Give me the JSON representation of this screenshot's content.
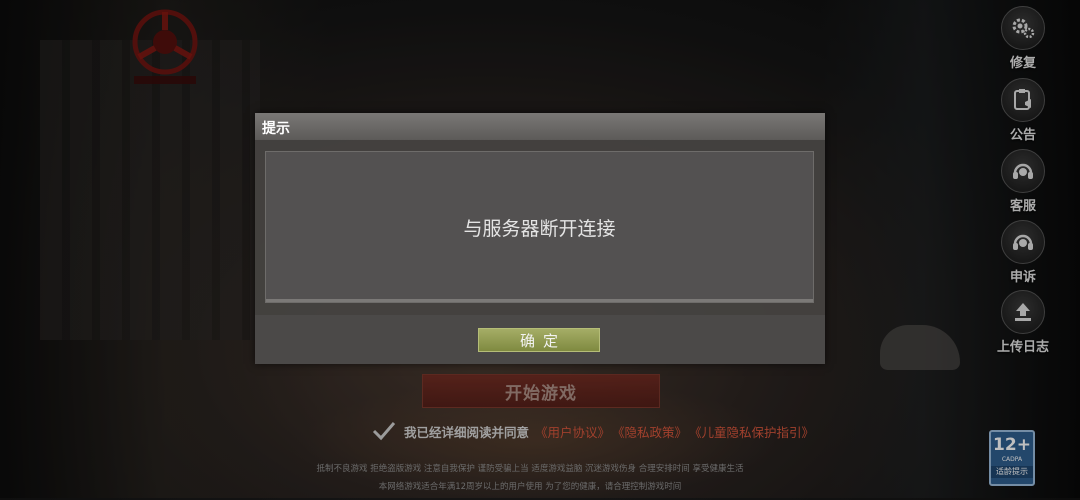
{
  "side_menu": [
    {
      "label": "修复",
      "icon": "gear-icon"
    },
    {
      "label": "公告",
      "icon": "announcement-icon"
    },
    {
      "label": "客服",
      "icon": "headset-icon"
    },
    {
      "label": "申诉",
      "icon": "appeal-headset-icon"
    },
    {
      "label": "上传日志",
      "icon": "upload-icon"
    }
  ],
  "start_button": {
    "label": "开始游戏"
  },
  "agreement": {
    "text": "我已经详细阅读并同意",
    "links": [
      "《用户协议》",
      "《隐私政策》",
      "《儿童隐私保护指引》"
    ]
  },
  "footer": {
    "line1": "抵制不良游戏 拒绝盗版游戏 注意自我保护 谨防受骗上当 适度游戏益脑 沉迷游戏伤身 合理安排时间 享受健康生活",
    "line2": "本网络游戏适合年满12周岁以上的用户使用   为了您的健康，请合理控制游戏时间"
  },
  "age_rating": {
    "value": "12+",
    "org": "CADPA",
    "tip": "适龄提示"
  },
  "dialog": {
    "title": "提示",
    "message": "与服务器断开连接",
    "confirm_label": "确定"
  },
  "colors": {
    "accent_red": "#d7563c",
    "confirm_green": "#8f9a50",
    "rating_blue": "#2f5f8f"
  }
}
